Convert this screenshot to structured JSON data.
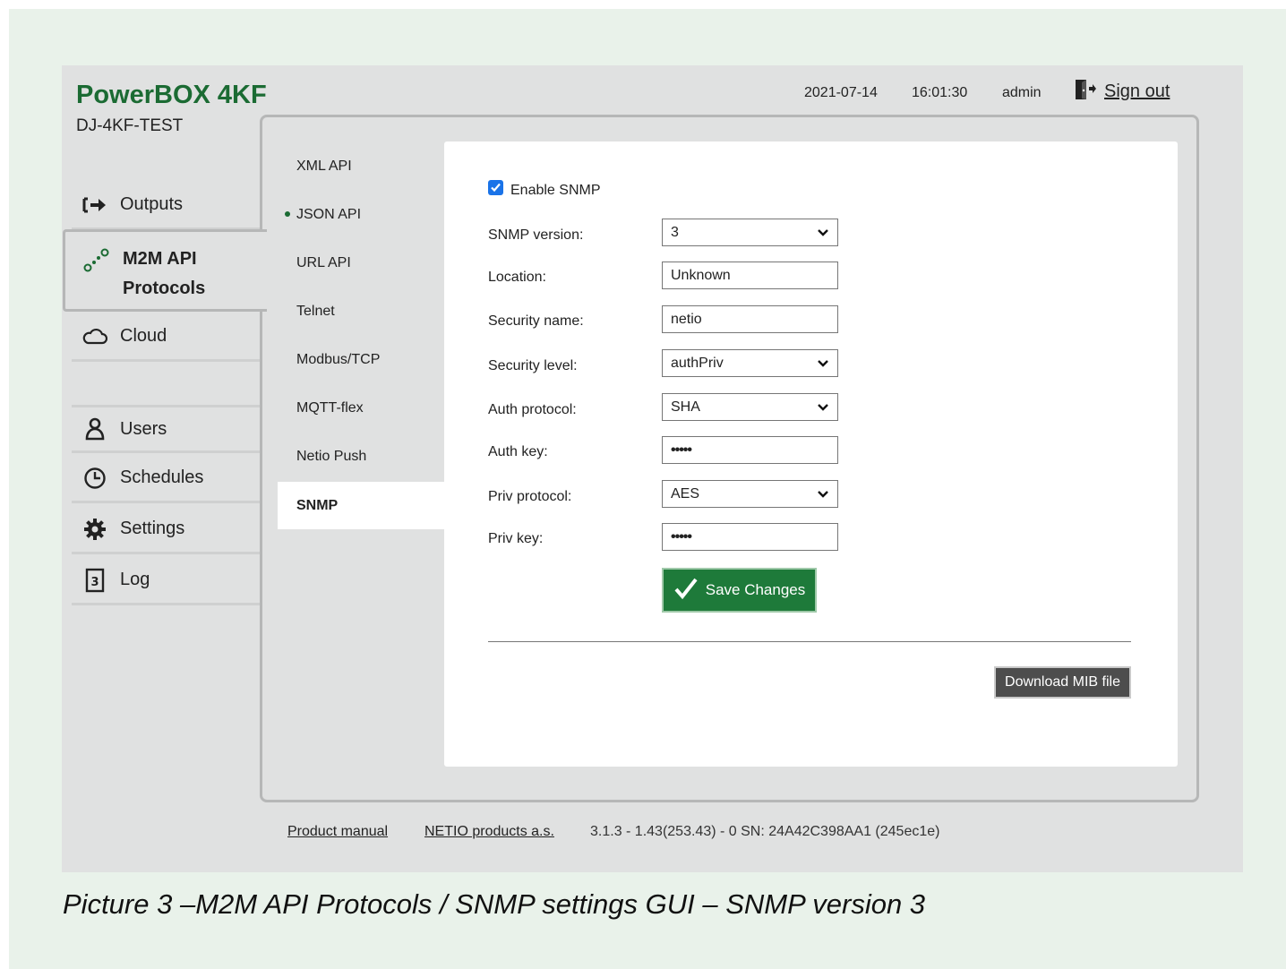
{
  "app": {
    "brand": "PowerBOX 4KF",
    "device_name": "DJ-4KF-TEST"
  },
  "topbar": {
    "date": "2021-07-14",
    "time": "16:01:30",
    "user": "admin",
    "sign_out": "Sign out"
  },
  "sidebar": {
    "items": [
      {
        "label": "Outputs",
        "icon": "arrow-right-bar-icon"
      },
      {
        "label_line1": "M2M API",
        "label_line2": "Protocols",
        "icon": "m2m-nodes-icon",
        "active": true
      },
      {
        "label": "Cloud",
        "icon": "cloud-icon"
      },
      {
        "label": "Users",
        "icon": "user-icon"
      },
      {
        "label": "Schedules",
        "icon": "clock-icon"
      },
      {
        "label": "Settings",
        "icon": "gear-icon"
      },
      {
        "label": "Log",
        "icon": "log-icon"
      }
    ]
  },
  "subnav": {
    "items": [
      "XML API",
      "JSON API",
      "URL API",
      "Telnet",
      "Modbus/TCP",
      "MQTT-flex",
      "Netio Push",
      "SNMP"
    ],
    "active": "SNMP",
    "marked": "JSON API"
  },
  "form": {
    "enable_label": "Enable SNMP",
    "enable_checked": true,
    "fields": {
      "snmp_version": {
        "label": "SNMP version:",
        "value": "3"
      },
      "location": {
        "label": "Location:",
        "value": "Unknown"
      },
      "security_name": {
        "label": "Security name:",
        "value": "netio"
      },
      "security_level": {
        "label": "Security level:",
        "value": "authPriv"
      },
      "auth_protocol": {
        "label": "Auth protocol:",
        "value": "SHA"
      },
      "auth_key": {
        "label": "Auth key:",
        "value": "•••••"
      },
      "priv_protocol": {
        "label": "Priv protocol:",
        "value": "AES"
      },
      "priv_key": {
        "label": "Priv key:",
        "value": "•••••"
      }
    },
    "save_label": "Save Changes",
    "download_label": "Download MIB file"
  },
  "footer": {
    "manual_link": "Product manual",
    "company_link": "NETIO products a.s.",
    "version": "3.1.3 - 1.43(253.43) - 0 SN: 24A42C398AA1 (245ec1e)"
  },
  "caption": "Picture 3 –M2M API Protocols / SNMP settings GUI – SNMP version 3",
  "colors": {
    "brand_green": "#1b6b33",
    "save_green": "#1e7a3a",
    "checkbox_blue": "#1a73e8",
    "page_background": "#e9f2ea",
    "app_background": "#e0e1e1"
  }
}
